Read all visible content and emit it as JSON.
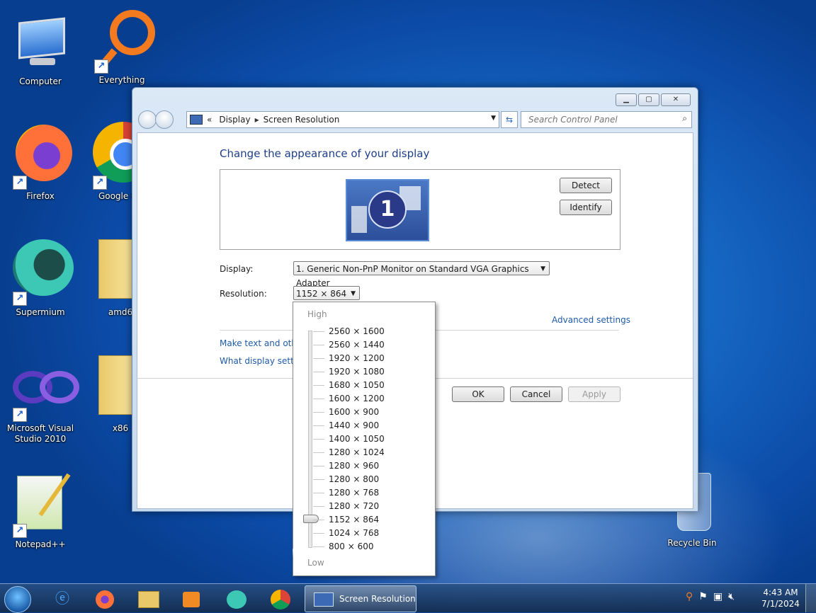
{
  "desktop": {
    "icons": [
      {
        "label": "Computer"
      },
      {
        "label": "Everything"
      },
      {
        "label": "Firefox"
      },
      {
        "label": "Google Ch"
      },
      {
        "label": "Supermium"
      },
      {
        "label": "amd6"
      },
      {
        "label": "Microsoft Visual Studio 2010"
      },
      {
        "label": "x86"
      },
      {
        "label": "Notepad++"
      },
      {
        "label": "Recycle Bin"
      }
    ]
  },
  "window": {
    "breadcrumb": [
      "Display",
      "Screen Resolution"
    ],
    "breadcrumb_prefix": "«",
    "search_placeholder": "Search Control Panel",
    "heading": "Change the appearance of your display",
    "monitor_number": "1",
    "detect_label": "Detect",
    "identify_label": "Identify",
    "display_label": "Display:",
    "display_value": "1. Generic Non-PnP Monitor on Standard VGA Graphics Adapter",
    "resolution_label": "Resolution:",
    "resolution_value": "1152 × 864",
    "advanced_link": "Advanced settings",
    "link_text_size": "Make text and other",
    "link_display_settings": "What display setting",
    "ok_label": "OK",
    "cancel_label": "Cancel",
    "apply_label": "Apply"
  },
  "resolution_dropdown": {
    "high_label": "High",
    "low_label": "Low",
    "options": [
      "2560 × 1600",
      "2560 × 1440",
      "1920 × 1200",
      "1920 × 1080",
      "1680 × 1050",
      "1600 × 1200",
      "1600 × 900",
      "1440 × 900",
      "1400 × 1050",
      "1280 × 1024",
      "1280 × 960",
      "1280 × 800",
      "1280 × 768",
      "1280 × 720",
      "1152 × 864",
      "1024 × 768",
      "800 × 600"
    ],
    "selected": "1152 × 864"
  },
  "taskbar": {
    "active_task": "Screen Resolution",
    "time": "4:43 AM",
    "date": "7/1/2024"
  },
  "colors": {
    "link": "#1e5aa8",
    "heading": "#1e3f8a",
    "desktop": "#1566c2"
  }
}
